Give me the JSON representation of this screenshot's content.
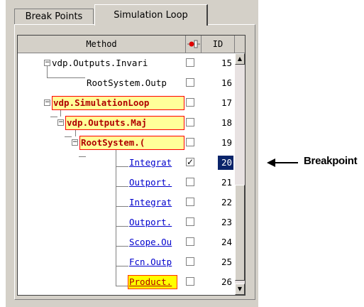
{
  "tabs": [
    {
      "label": "Break Points",
      "active": false
    },
    {
      "label": "Simulation Loop",
      "active": true
    }
  ],
  "table": {
    "columns": {
      "method": "Method",
      "breakpoint_icon": "breakpoint-column-icon",
      "id": "ID"
    },
    "rows": [
      {
        "method": "vdp.Outputs.Invari",
        "style": "plain",
        "checked": false,
        "id": "15"
      },
      {
        "method": "RootSystem.Outp",
        "style": "plain",
        "checked": false,
        "id": "16"
      },
      {
        "method": "vdp.SimulationLoop",
        "style": "highlight",
        "checked": false,
        "id": "17"
      },
      {
        "method": "vdp.Outputs.Maj",
        "style": "highlight",
        "checked": false,
        "id": "18"
      },
      {
        "method": "RootSystem.(",
        "style": "highlight",
        "checked": false,
        "id": "19"
      },
      {
        "method": "Integrat",
        "style": "link",
        "checked": true,
        "id": "20",
        "selected": true
      },
      {
        "method": "Outport.",
        "style": "link",
        "checked": false,
        "id": "21"
      },
      {
        "method": "Integrat",
        "style": "link",
        "checked": false,
        "id": "22"
      },
      {
        "method": "Outport.",
        "style": "link",
        "checked": false,
        "id": "23"
      },
      {
        "method": "Scope.Ou",
        "style": "link",
        "checked": false,
        "id": "24"
      },
      {
        "method": "Fcn.Outp",
        "style": "link",
        "checked": false,
        "id": "25"
      },
      {
        "method": "Product.",
        "style": "current",
        "checked": false,
        "id": "26"
      }
    ]
  },
  "annotation": {
    "label": "Breakpoint"
  },
  "colors": {
    "highlight_border": "#ff0000",
    "highlight_fill": "#ffff99",
    "link": "#0000cc",
    "selected_id_bg": "#0a246a"
  }
}
